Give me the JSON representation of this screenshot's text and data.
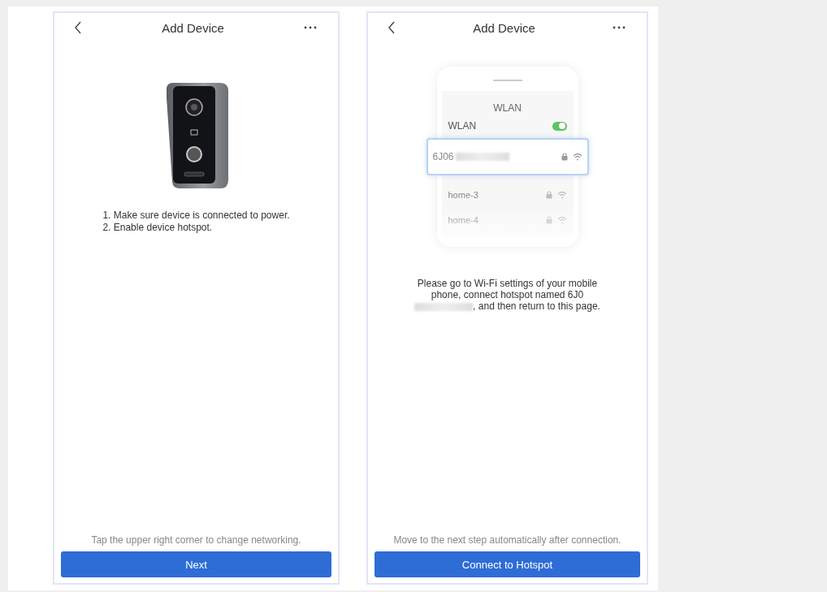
{
  "screens": [
    {
      "kind": "device",
      "title": "Add Device",
      "steps": [
        "1. Make sure device is connected to power.",
        "2. Enable device hotspot."
      ],
      "hint": "Tap the upper right corner to change networking.",
      "button": "Next"
    },
    {
      "kind": "wifi",
      "title": "Add Device",
      "wlan": {
        "heading": "WLAN",
        "toggle_label": "WLAN",
        "toggle_on": true,
        "networks": [
          {
            "name": "6J06",
            "selected": true
          },
          {
            "name": "home-3",
            "selected": false
          },
          {
            "name": "home-4",
            "selected": false
          }
        ]
      },
      "message_before": "Please go to Wi-Fi settings of your mobile phone, connect hotspot named 6J0",
      "message_after": ", and then return to this page.",
      "hint": "Move to the next step automatically after connection.",
      "button": "Connect to Hotspot"
    }
  ]
}
